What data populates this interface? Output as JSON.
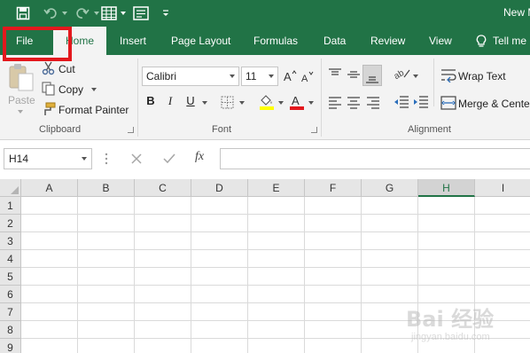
{
  "app": {
    "document_title": "New M",
    "accent": "#217346",
    "highlight": "#e3181d"
  },
  "quick_access": {
    "icons": [
      "save-icon",
      "undo-icon",
      "redo-icon",
      "table-icon",
      "form-icon",
      "customize-qat-icon"
    ]
  },
  "tabs": [
    {
      "id": "file",
      "label": "File"
    },
    {
      "id": "home",
      "label": "Home",
      "active": true
    },
    {
      "id": "insert",
      "label": "Insert"
    },
    {
      "id": "page_layout",
      "label": "Page Layout"
    },
    {
      "id": "formulas",
      "label": "Formulas"
    },
    {
      "id": "data",
      "label": "Data"
    },
    {
      "id": "review",
      "label": "Review"
    },
    {
      "id": "view",
      "label": "View"
    },
    {
      "id": "tell_me",
      "label": "Tell me"
    }
  ],
  "ribbon": {
    "clipboard": {
      "label": "Clipboard",
      "paste": "Paste",
      "cut": "Cut",
      "copy": "Copy",
      "format_painter": "Format Painter"
    },
    "font": {
      "label": "Font",
      "font_name": "Calibri",
      "font_size": "11",
      "bold": "B",
      "italic": "I",
      "underline": "U",
      "fill_color": "#ffff00",
      "font_color": "#e3181d"
    },
    "alignment": {
      "label": "Alignment",
      "wrap_text": "Wrap Text",
      "merge_center": "Merge & Cente"
    }
  },
  "formula_bar": {
    "name_box": "H14",
    "fx": "fx",
    "formula": ""
  },
  "grid": {
    "columns": [
      "A",
      "B",
      "C",
      "D",
      "E",
      "F",
      "G",
      "H",
      "I"
    ],
    "selected_column": "H",
    "rows": [
      "1",
      "2",
      "3",
      "4",
      "5",
      "6",
      "7",
      "8",
      "9"
    ]
  },
  "watermark": {
    "main": "Bai 经验",
    "sub": "jingyan.baidu.com"
  }
}
